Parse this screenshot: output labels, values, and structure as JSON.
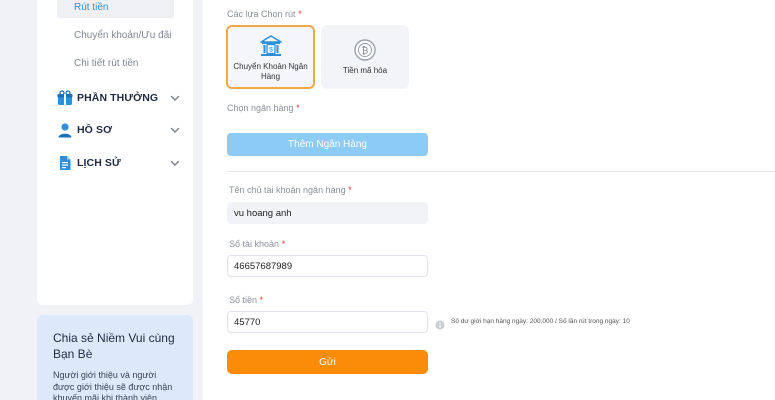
{
  "sidebar": {
    "sub_items": [
      {
        "label": "Rút tiền"
      },
      {
        "label": "Chuyển khoản/Ưu đãi"
      },
      {
        "label": "Chi tiết rút tiền"
      }
    ],
    "menu": [
      {
        "label": "PHẦN THƯỞNG",
        "icon": "gift-icon"
      },
      {
        "label": "HỒ SƠ",
        "icon": "user-icon"
      },
      {
        "label": "LỊCH SỬ",
        "icon": "document-icon"
      }
    ]
  },
  "share": {
    "title": "Chia sẻ Niềm Vui cùng Bạn Bè",
    "description": "Người giới thiệu và người được giới thiệu sẽ được nhận khuyến mãi khi thành viên"
  },
  "withdraw": {
    "options_label": "Các lựa Chọn rút",
    "options": [
      {
        "label": "Chuyển Khoản Ngân Hàng",
        "icon": "bank-transfer-icon",
        "selected": true
      },
      {
        "label": "Tiền mã hóa",
        "icon": "crypto-coin-icon",
        "selected": false
      }
    ],
    "bank_label": "Chọn ngân hàng",
    "add_bank_button": "Thêm Ngân Hàng",
    "account_holder_label": "Tên chủ tài khoản ngân hàng",
    "account_holder_value": "vu hoang anh",
    "account_number_label": "Số tài khoản",
    "account_number_value": "46657687989",
    "amount_label": "Số tiền",
    "amount_value": "45770",
    "limit_info": "Số dư giới hạn hàng ngày: 200,000 / Số lần rút trong ngày: 10",
    "submit_button": "Gửi",
    "required_mark": "*"
  },
  "colors": {
    "accent_blue": "#2f8fd8",
    "add_bank_button": "#8ccbf5",
    "submit_button": "#fb8c09",
    "selected_border": "#f1a84a",
    "required": "#e53935"
  }
}
